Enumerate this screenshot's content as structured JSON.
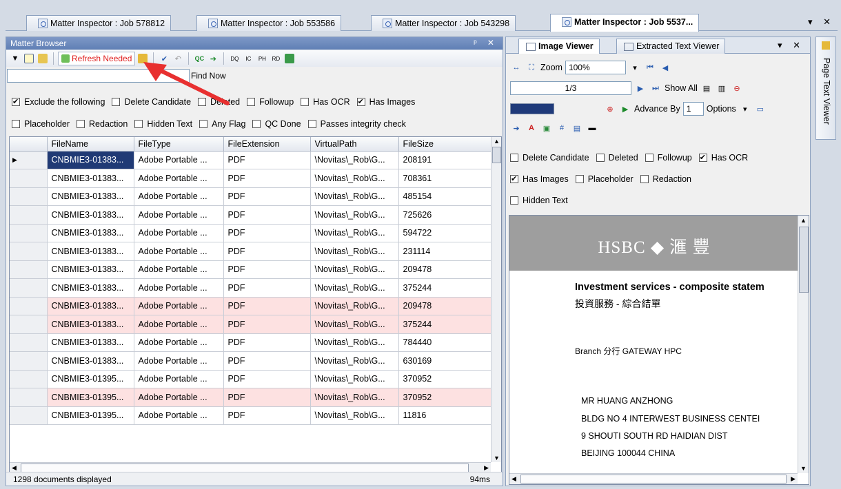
{
  "doc_tabs": [
    {
      "label": "Matter Inspector : Job 578812"
    },
    {
      "label": "Matter Inspector : Job 553586"
    },
    {
      "label": "Matter Inspector : Job 543298"
    },
    {
      "label": "Matter Inspector : Job 5537..."
    }
  ],
  "tab_controls": "▾ ✕",
  "browser": {
    "title": "Matter Browser",
    "controls": "ᵖ ✕",
    "refresh_label": "Refresh Needed",
    "search_placeholder": "",
    "find_now": "Find Now",
    "filters_row1": {
      "exclude": "Exclude the following",
      "delete_candidate": "Delete Candidate",
      "deleted": "Deleted",
      "followup": "Followup",
      "has_ocr": "Has OCR",
      "has_images": "Has Images"
    },
    "filters_row2": {
      "placeholder": "Placeholder",
      "redaction": "Redaction",
      "hidden_text": "Hidden Text",
      "any_flag": "Any Flag",
      "qc_done": "QC Done",
      "integrity": "Passes integrity check"
    },
    "columns": [
      "FileName",
      "FileType",
      "FileExtension",
      "VirtualPath",
      "FileSize"
    ],
    "rows": [
      [
        "CNBMIE3-01383...",
        "Adobe Portable ...",
        "PDF",
        "\\Novitas\\_Rob\\G...",
        "208191"
      ],
      [
        "CNBMIE3-01383...",
        "Adobe Portable ...",
        "PDF",
        "\\Novitas\\_Rob\\G...",
        "708361"
      ],
      [
        "CNBMIE3-01383...",
        "Adobe Portable ...",
        "PDF",
        "\\Novitas\\_Rob\\G...",
        "485154"
      ],
      [
        "CNBMIE3-01383...",
        "Adobe Portable ...",
        "PDF",
        "\\Novitas\\_Rob\\G...",
        "725626"
      ],
      [
        "CNBMIE3-01383...",
        "Adobe Portable ...",
        "PDF",
        "\\Novitas\\_Rob\\G...",
        "594722"
      ],
      [
        "CNBMIE3-01383...",
        "Adobe Portable ...",
        "PDF",
        "\\Novitas\\_Rob\\G...",
        "231114"
      ],
      [
        "CNBMIE3-01383...",
        "Adobe Portable ...",
        "PDF",
        "\\Novitas\\_Rob\\G...",
        "209478"
      ],
      [
        "CNBMIE3-01383...",
        "Adobe Portable ...",
        "PDF",
        "\\Novitas\\_Rob\\G...",
        "375244"
      ],
      [
        "CNBMIE3-01383...",
        "Adobe Portable ...",
        "PDF",
        "\\Novitas\\_Rob\\G...",
        "209478"
      ],
      [
        "CNBMIE3-01383...",
        "Adobe Portable ...",
        "PDF",
        "\\Novitas\\_Rob\\G...",
        "375244"
      ],
      [
        "CNBMIE3-01383...",
        "Adobe Portable ...",
        "PDF",
        "\\Novitas\\_Rob\\G...",
        "784440"
      ],
      [
        "CNBMIE3-01383...",
        "Adobe Portable ...",
        "PDF",
        "\\Novitas\\_Rob\\G...",
        "630169"
      ],
      [
        "CNBMIE3-01395...",
        "Adobe Portable ...",
        "PDF",
        "\\Novitas\\_Rob\\G...",
        "370952"
      ],
      [
        "CNBMIE3-01395...",
        "Adobe Portable ...",
        "PDF",
        "\\Novitas\\_Rob\\G...",
        "370952"
      ],
      [
        "CNBMIE3-01395...",
        "Adobe Portable ...",
        "PDF",
        "\\Novitas\\_Rob\\G...",
        "11816"
      ]
    ],
    "status_text": "1298 documents displayed",
    "status_time": "94ms"
  },
  "viewer": {
    "tab_image": "Image Viewer",
    "tab_text": "Extracted Text Viewer",
    "controls": "▾ ✕",
    "zoom_label": "Zoom",
    "zoom_value": "100%",
    "page_indicator": "1/3",
    "show_all": "Show All",
    "advance_by": "Advance By",
    "advance_value": "1",
    "options": "Options",
    "flags": {
      "delete_candidate": "Delete Candidate",
      "deleted": "Deleted",
      "followup": "Followup",
      "has_ocr": "Has OCR",
      "has_images": "Has Images",
      "placeholder": "Placeholder",
      "redaction": "Redaction",
      "hidden_text": "Hidden Text"
    },
    "document": {
      "logo": "HSBC ◆ 滙 豐",
      "heading_en": "Investment services - composite statem",
      "heading_cn": "投資服務 - 綜合結單",
      "branch": "Branch 分行    GATEWAY HPC",
      "address": [
        "MR HUANG ANZHONG",
        "BLDG NO 4 INTERWEST BUSINESS CENTEI",
        "9 SHOUTI SOUTH RD HAIDIAN DIST",
        "BEIJING 100044 CHINA"
      ]
    }
  },
  "side_tab": "Page Text Viewer"
}
